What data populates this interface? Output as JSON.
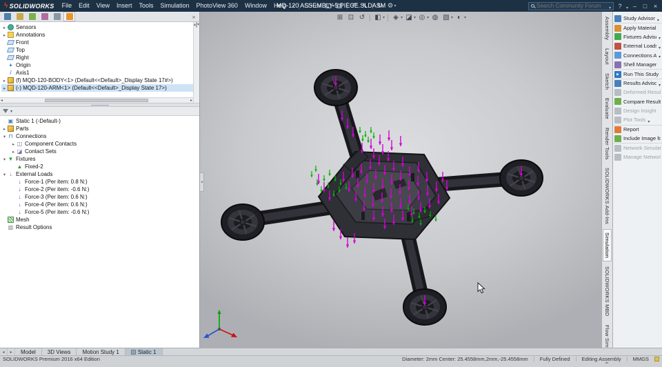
{
  "titlebar": {
    "logo_text": "SOLIDWORKS",
    "menus": [
      "File",
      "Edit",
      "View",
      "Insert",
      "Tools",
      "Simulation",
      "PhotoView 360",
      "Window",
      "Help"
    ],
    "doc_title": "MQ-120 ASSEMBLY-5 PIECE.SLDASM",
    "search_placeholder": "Search Community Forum",
    "help_label": "?"
  },
  "toolbar_icons": [
    {
      "name": "new",
      "glyph": "□"
    },
    {
      "name": "open",
      "glyph": "▭"
    },
    {
      "name": "save",
      "glyph": "◫"
    },
    {
      "name": "print",
      "glyph": "▤"
    },
    {
      "name": "undo",
      "glyph": "↶"
    },
    {
      "name": "select",
      "glyph": "↖"
    },
    {
      "name": "rebuild",
      "glyph": "↻"
    },
    {
      "name": "options",
      "glyph": "⚙"
    }
  ],
  "viewport_toolbar": [
    {
      "name": "zoom-fit",
      "glyph": "⊞"
    },
    {
      "name": "zoom-area",
      "glyph": "⊡"
    },
    {
      "name": "previous-view",
      "glyph": "↺"
    },
    {
      "name": "section-view",
      "glyph": "◧"
    },
    {
      "name": "view-orientation",
      "glyph": "◈"
    },
    {
      "name": "display-style",
      "glyph": "◪"
    },
    {
      "name": "hide-show",
      "glyph": "◎"
    },
    {
      "name": "edit-appearance",
      "glyph": "◍"
    },
    {
      "name": "apply-scene",
      "glyph": "▧"
    },
    {
      "name": "view-settings",
      "glyph": "◐"
    }
  ],
  "feature_tree": {
    "items": [
      {
        "expand": "▸",
        "label": "Sensors"
      },
      {
        "expand": "▸",
        "label": "Annotations"
      },
      {
        "expand": "",
        "label": "Front"
      },
      {
        "expand": "",
        "label": "Top"
      },
      {
        "expand": "",
        "label": "Right"
      },
      {
        "expand": "",
        "label": "Origin"
      },
      {
        "expand": "",
        "label": "Axis1"
      },
      {
        "expand": "▸",
        "label": "(f) MQD-120-BODY<1> (Default<<Default>_Display State 17#>)"
      },
      {
        "expand": "▸",
        "label": "(-) MQD-120-ARM<1> (Default<<Default>_Display State 17>)"
      }
    ]
  },
  "study_tree": {
    "title": "Static 1 (-Default-)",
    "items": [
      {
        "expand": "▸",
        "label": "Parts"
      },
      {
        "expand": "▾",
        "label": "Connections"
      },
      {
        "expand": "▸",
        "label": "Component Contacts"
      },
      {
        "expand": "▸",
        "label": "Contact Sets"
      },
      {
        "expand": "▾",
        "label": "Fixtures"
      },
      {
        "expand": "",
        "label": "Fixed-2"
      },
      {
        "expand": "▾",
        "label": "External Loads"
      },
      {
        "expand": "",
        "label": "Force-1 (Per item: 0.8 N:)"
      },
      {
        "expand": "",
        "label": "Force-2 (Per item: -0.6 N:)"
      },
      {
        "expand": "",
        "label": "Force-3 (Per item: 0.6 N:)"
      },
      {
        "expand": "",
        "label": "Force-4 (Per item: 0.6 N:)"
      },
      {
        "expand": "",
        "label": "Force-5 (Per item: -0.6 N:)"
      },
      {
        "expand": "",
        "label": "Mesh"
      },
      {
        "expand": "",
        "label": "Result Options"
      }
    ]
  },
  "command_panel": {
    "items": [
      {
        "label": "Study Advisor"
      },
      {
        "label": "Apply Material"
      },
      {
        "label": "Fixtures Advisor"
      },
      {
        "label": "External Loads Ad..."
      },
      {
        "label": "Connections Advi..."
      },
      {
        "label": "Shell Manager"
      },
      {
        "label": "Run This Study"
      },
      {
        "label": "Results Advisor"
      },
      {
        "label": "Deformed Result"
      },
      {
        "label": "Compare Results"
      },
      {
        "label": "Design Insight"
      },
      {
        "label": "Plot Tools"
      },
      {
        "label": "Report"
      },
      {
        "label": "Include Image for Re..."
      },
      {
        "label": "Network Simulation"
      },
      {
        "label": "Manage Network"
      }
    ]
  },
  "vertical_tabs": {
    "items": [
      "Assembly",
      "Layout",
      "Sketch",
      "Evaluate",
      "Render Tools",
      "SOLIDWORKS Add-Ins",
      "Simulation",
      "SOLIDWORKS MBD",
      "Flow Simulation"
    ],
    "active": "Simulation"
  },
  "bottom_tabs": {
    "items": [
      "Model",
      "3D Views",
      "Motion Study 1",
      "Static 1"
    ],
    "active": "Static 1"
  },
  "status_bar": {
    "edition": "SOLIDWORKS Premium 2016 x64 Edition",
    "measurement": "Diameter: 2mm  Center: 25.4558mm,2mm,-25.4558mm",
    "state": "Fully Defined",
    "mode": "Editing Assembly",
    "units": "MMGS"
  }
}
